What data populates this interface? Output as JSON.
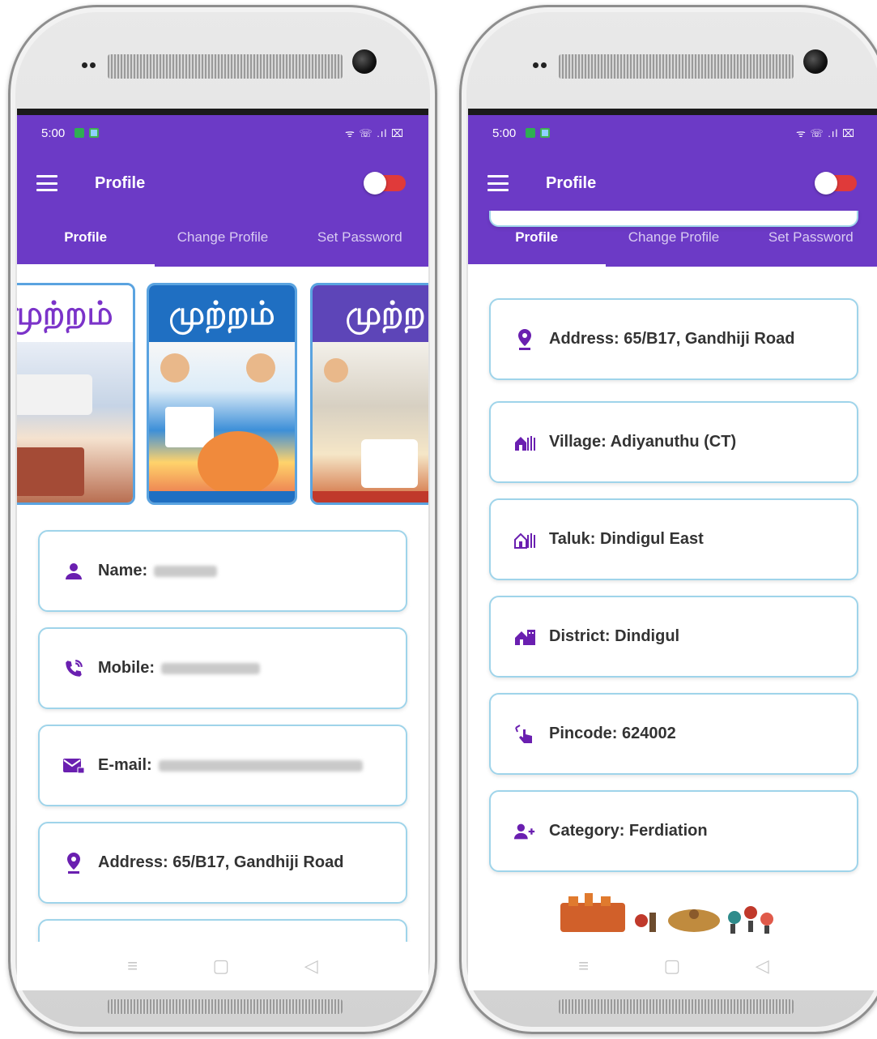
{
  "status_bar": {
    "time": "5:00",
    "signal_text": "ᯤ ☏ .ıl ⌧"
  },
  "toolbar": {
    "title": "Profile"
  },
  "tabs": [
    {
      "label": "Profile"
    },
    {
      "label": "Change Profile"
    },
    {
      "label": "Set Password"
    }
  ],
  "magazines": [
    {
      "title": "முற்றம்"
    },
    {
      "title": "முற்றம்"
    },
    {
      "title": "முற்ற"
    }
  ],
  "left_cards": {
    "name": "Name:",
    "mobile": "Mobile:",
    "email": "E-mail:",
    "address": "Address: 65/B17, Gandhiji Road"
  },
  "right_cards": {
    "address": "Address: 65/B17, Gandhiji Road",
    "village": "Village: Adiyanuthu (CT)",
    "taluk": "Taluk: Dindigul East",
    "district": "District: Dindigul",
    "pincode": "Pincode: 624002",
    "category": "Category: Ferdiation"
  },
  "nav": {
    "menu": "≡",
    "home": "▢",
    "back": "◁"
  },
  "colors": {
    "primary": "#6c3ac6",
    "icon": "#6a1fb0",
    "card_border": "#9fd4ea",
    "toggle": "#e03a3a"
  }
}
